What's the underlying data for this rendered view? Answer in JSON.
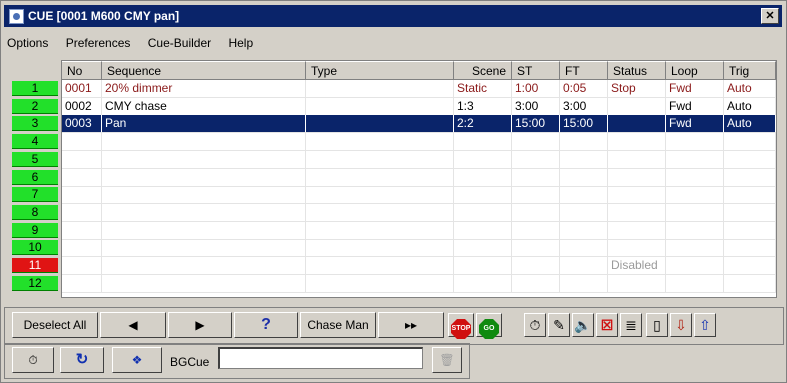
{
  "window": {
    "title": "CUE [0001 M600 CMY pan]",
    "close_label": "x"
  },
  "menu": [
    "Options",
    "Preferences",
    "Cue-Builder",
    "Help"
  ],
  "side_buttons": [
    "1",
    "2",
    "3",
    "4",
    "5",
    "6",
    "7",
    "8",
    "9",
    "10",
    "11",
    "12"
  ],
  "columns": [
    "No",
    "Sequence",
    "Type",
    "Scene",
    "ST",
    "FT",
    "Status",
    "Loop",
    "Trig"
  ],
  "rows": [
    {
      "no": "0001",
      "sequence": "20% dimmer",
      "type": "",
      "scene": "Static",
      "st": "1:00",
      "ft": "0:05",
      "status": "Stop",
      "loop": "Fwd",
      "trig": "Auto"
    },
    {
      "no": "0002",
      "sequence": "CMY chase",
      "type": "",
      "scene": "1:3",
      "st": "3:00",
      "ft": "3:00",
      "status": "",
      "loop": "Fwd",
      "trig": "Auto"
    },
    {
      "no": "0003",
      "sequence": "Pan",
      "type": "",
      "scene": "2:2",
      "st": "15:00",
      "ft": "15:00",
      "status": "",
      "loop": "Fwd",
      "trig": "Auto"
    }
  ],
  "disabled_label": "Disabled",
  "toolbar": {
    "deselect_all": "Deselect All",
    "prev": "◀",
    "next": "▶",
    "help": "?",
    "chase_man": "Chase Man",
    "ffwd": "▸▸",
    "stop": "STOP",
    "go": "GO",
    "bgcue_label": "BGCue",
    "bgcue_value": ""
  },
  "colors": {
    "green": "#22e02a",
    "red": "#e01414",
    "selection": "#0a246a",
    "title": "#0a246a"
  }
}
